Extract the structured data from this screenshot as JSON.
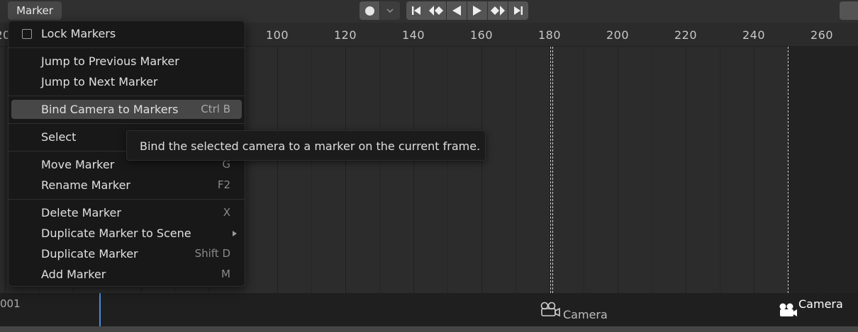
{
  "header": {
    "menu_label": "Marker",
    "icons": [
      "record-icon",
      "chevron-down-icon",
      "jump-to-start-icon",
      "jump-to-previous-keyframe-icon",
      "play-reverse-icon",
      "play-icon",
      "jump-to-next-keyframe-icon",
      "jump-to-end-icon"
    ]
  },
  "ruler": {
    "left_partial": "20",
    "ticks": [
      "100",
      "120",
      "140",
      "160",
      "180",
      "200",
      "220",
      "240",
      "260"
    ]
  },
  "timeline": {
    "current_frame_partial": "001",
    "markers": [
      {
        "name": "Camera",
        "selected": false
      },
      {
        "name": "Camera",
        "selected": true
      }
    ]
  },
  "menu": {
    "lock_markers": "Lock Markers",
    "jump_prev": "Jump to Previous Marker",
    "jump_next": "Jump to Next Marker",
    "bind_camera": "Bind Camera to Markers",
    "bind_camera_shortcut": "Ctrl B",
    "select": "Select",
    "move": "Move Marker",
    "move_shortcut": "G",
    "rename": "Rename Marker",
    "rename_shortcut": "F2",
    "delete": "Delete Marker",
    "delete_shortcut": "X",
    "duplicate_to_scene": "Duplicate Marker to Scene",
    "duplicate": "Duplicate Marker",
    "duplicate_shortcut": "Shift D",
    "add": "Add Marker",
    "add_shortcut": "M"
  },
  "tooltip": {
    "text": "Bind the selected camera to a marker on the current frame."
  },
  "colors": {
    "highlight": "#474747",
    "playhead": "#4a8be0",
    "menu_bg": "#181818"
  }
}
